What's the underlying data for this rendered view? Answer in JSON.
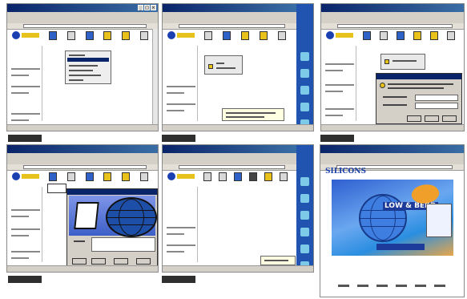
{
  "colors": {
    "titlebar": "#0a246a",
    "chrome": "#d4d0c8",
    "taskpane": "#2054b0",
    "caption_bar": "#2f2f2f"
  },
  "window": {
    "title": "",
    "menu": ""
  },
  "panels": [
    {
      "id": 1,
      "state": "context-menu-open",
      "has_caption_bar": true
    },
    {
      "id": 2,
      "state": "tooltip-balloon",
      "has_caption_bar": true
    },
    {
      "id": 3,
      "state": "warning-dialog",
      "has_caption_bar": true
    },
    {
      "id": 4,
      "state": "wizard-dialog-globe",
      "has_caption_bar": true
    },
    {
      "id": 5,
      "state": "taskbar-notification",
      "has_caption_bar": true
    },
    {
      "id": 6,
      "state": "product-splash-page",
      "has_caption_bar": false
    }
  ],
  "splash": {
    "brand": "SILICONS",
    "tagline": "LOW & BERD",
    "subline": ""
  },
  "icons": [
    "globe-icon",
    "printer-icon",
    "folder-icon",
    "network-icon",
    "mail-icon",
    "drive-icon"
  ]
}
